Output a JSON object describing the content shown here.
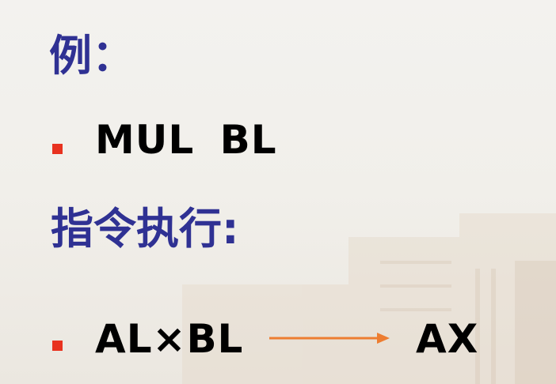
{
  "slide": {
    "title_example": "例：",
    "instruction": "MUL  BL",
    "title_execution": "指令执行:",
    "operation_expr": "AL×BL",
    "operation_result": "AX"
  },
  "colors": {
    "heading": "#2f3193",
    "bullet": "#e8321f",
    "arrow": "#ed7d31",
    "text": "#000000"
  }
}
